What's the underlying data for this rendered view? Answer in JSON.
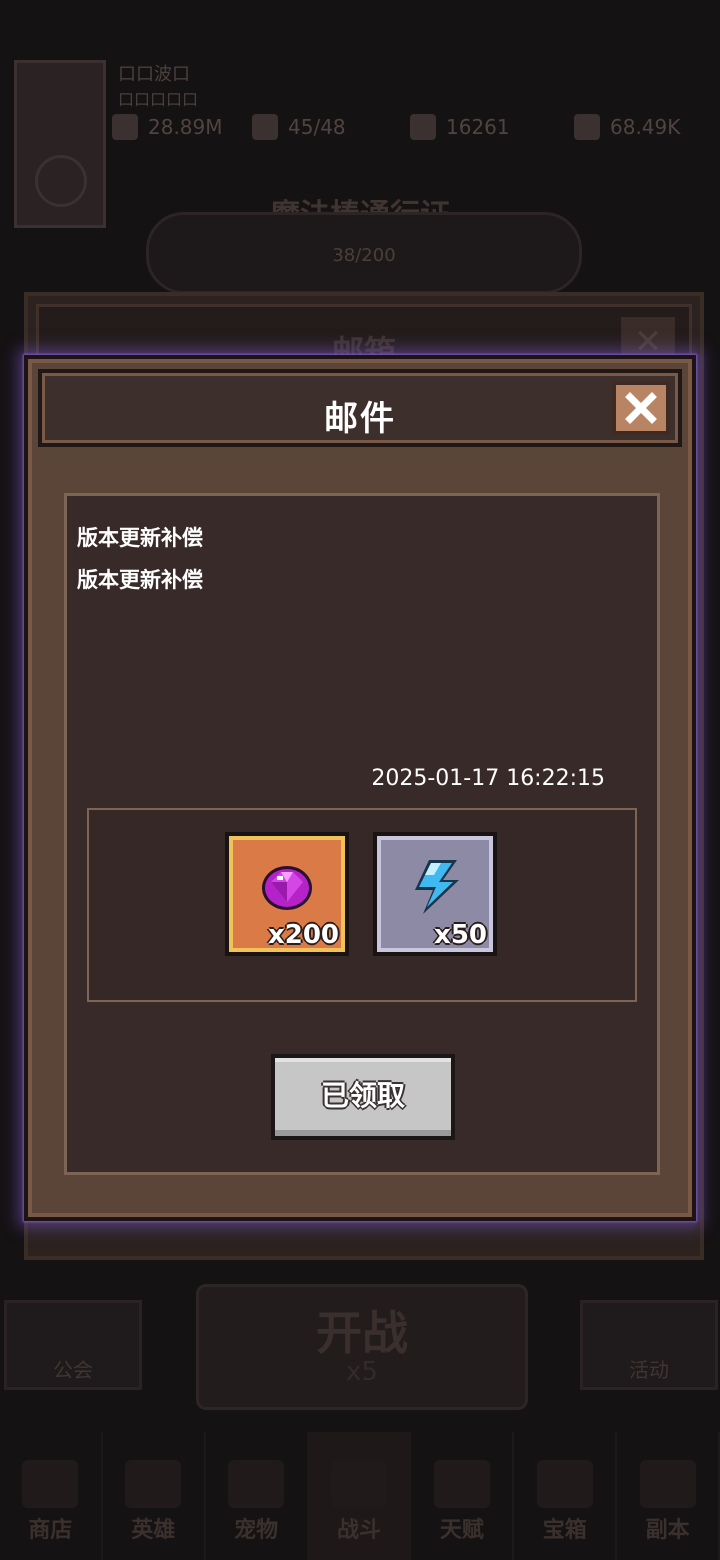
{
  "background": {
    "player": {
      "name": "口口波口",
      "subtitle": "口口口口口"
    },
    "resources": [
      {
        "icon": "power-icon",
        "value": "28.89M"
      },
      {
        "icon": "stamina-icon",
        "value": "45/48"
      },
      {
        "icon": "gem-icon",
        "value": "16261"
      },
      {
        "icon": "coin-icon",
        "value": "68.49K"
      }
    ],
    "pass": {
      "title": "魔法棒通行证",
      "progress": "38/200"
    },
    "mailbox": {
      "title": "邮箱",
      "close_symbol": "✕"
    },
    "guild_button": "公会",
    "other_button": "活动",
    "battle": {
      "title": "开战",
      "cost": "x5"
    },
    "bottom_nav": [
      "商店",
      "英雄",
      "宠物",
      "战斗",
      "天赋",
      "宝箱",
      "副本"
    ]
  },
  "modal": {
    "title": "邮件",
    "mail": {
      "subject": "版本更新补偿",
      "body": "版本更新补偿",
      "date": "2025-01-17 16:22:15"
    },
    "rewards": [
      {
        "icon": "purple-gem-icon",
        "quantity": "x200",
        "frame_color": "#d97a47"
      },
      {
        "icon": "lightning-energy-icon",
        "quantity": "x50",
        "frame_color": "#8d8aa6"
      }
    ],
    "claim_button": "已领取"
  },
  "colors": {
    "modal_glow": "#7a5ec0",
    "panel_bg": "#382a29",
    "modal_bg": "#5a4538",
    "close_button": "#b98463"
  }
}
